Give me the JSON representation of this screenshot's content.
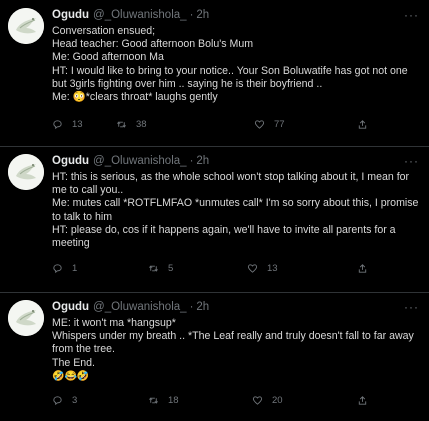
{
  "tweets": [
    {
      "name": "Ogudu",
      "handle": "@_Oluwanishola_",
      "separator": "·",
      "time": "2h",
      "lines": [
        "Conversation ensued;",
        "Head teacher: Good afternoon Bolu's Mum",
        "Me: Good afternoon Ma",
        "HT: I would like to bring to your notice.. Your Son Boluwatife has got not one but 3girls fighting over him .. saying he is their boyfriend ..",
        "Me: 😳*clears throat* laughs gently"
      ],
      "replies": "13",
      "retweets": "38",
      "likes": "77"
    },
    {
      "name": "Ogudu",
      "handle": "@_Oluwanishola_",
      "separator": "·",
      "time": "2h",
      "lines": [
        "HT: this is serious, as the whole school won't stop talking about it, I mean for me to call you..",
        "Me: mutes call *ROTFLMFAO *unmutes call* I'm so sorry about this, I promise to talk to him",
        "HT: please do, cos if it happens again, we'll have to invite all parents for a meeting"
      ],
      "replies": "1",
      "retweets": "5",
      "likes": "13"
    },
    {
      "name": "Ogudu",
      "handle": "@_Oluwanishola_",
      "separator": "·",
      "time": "2h",
      "lines": [
        "ME: it won't ma *hangsup*",
        "Whispers under my breath .. *The Leaf really and truly doesn't fall to far away from the tree.",
        "The End.",
        "🤣😂🤣"
      ],
      "replies": "3",
      "retweets": "18",
      "likes": "20"
    }
  ],
  "icons": {
    "more": "more-icon",
    "reply": "reply-icon",
    "retweet": "retweet-icon",
    "like": "heart-icon",
    "share": "share-icon",
    "avatar": "dove-avatar"
  },
  "colors": {
    "background": "#000000",
    "text": "#d9d9d9",
    "muted": "#71767b",
    "divider": "#2f3336"
  }
}
